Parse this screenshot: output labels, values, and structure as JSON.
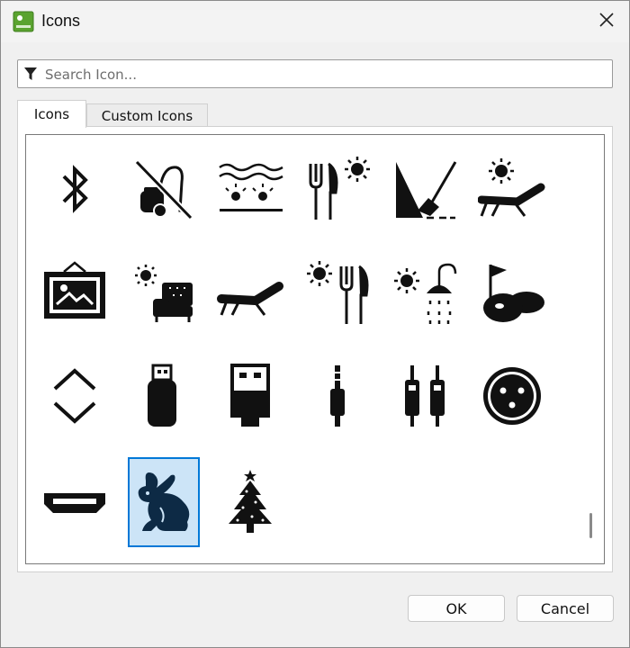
{
  "window": {
    "title": "Icons",
    "app_icon": "app-logo-icon",
    "close_icon": "close-icon"
  },
  "search": {
    "placeholder": "Search Icon...",
    "value": "",
    "icon": "filter-icon"
  },
  "tabs": [
    {
      "label": "Icons",
      "active": true
    },
    {
      "label": "Custom Icons",
      "active": false
    }
  ],
  "icons": [
    {
      "name": "bluetooth-icon"
    },
    {
      "name": "no-vacuum-cleaner-icon"
    },
    {
      "name": "heated-pool-icon"
    },
    {
      "name": "outdoor-dining-icon"
    },
    {
      "name": "broom-sweeping-icon"
    },
    {
      "name": "sun-lounger-icon"
    },
    {
      "name": "framed-picture-icon"
    },
    {
      "name": "outdoor-sofa-icon"
    },
    {
      "name": "lounge-chair-icon"
    },
    {
      "name": "outdoor-restaurant-icon"
    },
    {
      "name": "outdoor-shower-icon"
    },
    {
      "name": "golf-course-icon"
    },
    {
      "name": "up-down-arrows-icon"
    },
    {
      "name": "usb-stick-icon"
    },
    {
      "name": "usb-connector-icon"
    },
    {
      "name": "audio-jack-icon"
    },
    {
      "name": "rca-cables-icon"
    },
    {
      "name": "xlr-connector-icon"
    },
    {
      "name": "hdmi-connector-icon"
    },
    {
      "name": "rabbit-icon",
      "selected": true
    },
    {
      "name": "christmas-tree-icon"
    }
  ],
  "buttons": {
    "ok_label": "OK",
    "cancel_label": "Cancel"
  },
  "colors": {
    "selection_bg": "#cce4f7",
    "selection_border": "#0078d7",
    "icon_fill": "#111111",
    "selected_icon_fill": "#0d2a45"
  }
}
